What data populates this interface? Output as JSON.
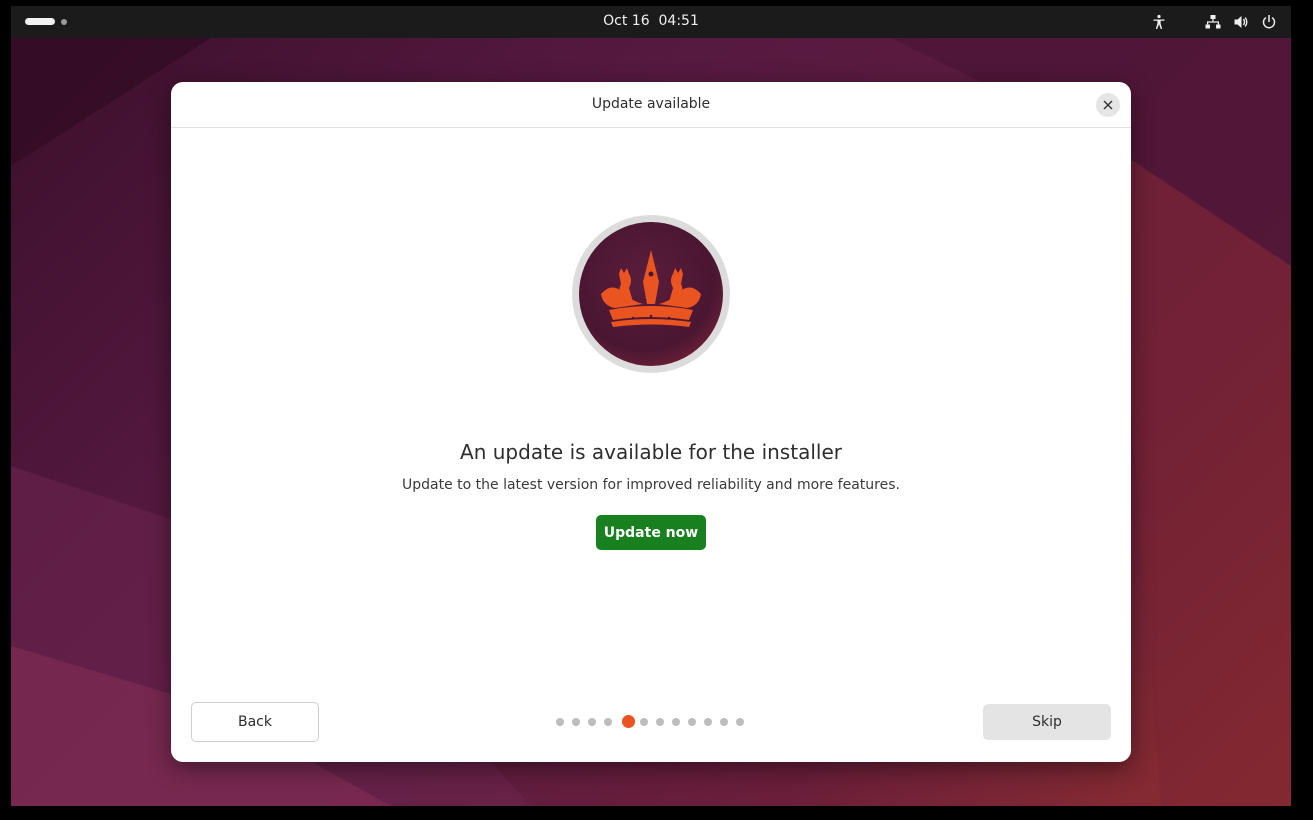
{
  "topbar": {
    "clock": "Oct 16  04:51",
    "tray_icons": [
      "accessibility-icon",
      "network-icon",
      "volume-icon",
      "power-icon"
    ]
  },
  "dialog": {
    "title": "Update available",
    "headline": "An update is available for the installer",
    "subtext": "Update to the latest version for improved reliability and more features.",
    "update_label": "Update now",
    "back_label": "Back",
    "skip_label": "Skip",
    "pager": {
      "total": 12,
      "current": 5
    }
  },
  "colors": {
    "accent": "#e95420",
    "primary_button": "#18801f",
    "emblem_bg": "#5a1d3c"
  }
}
